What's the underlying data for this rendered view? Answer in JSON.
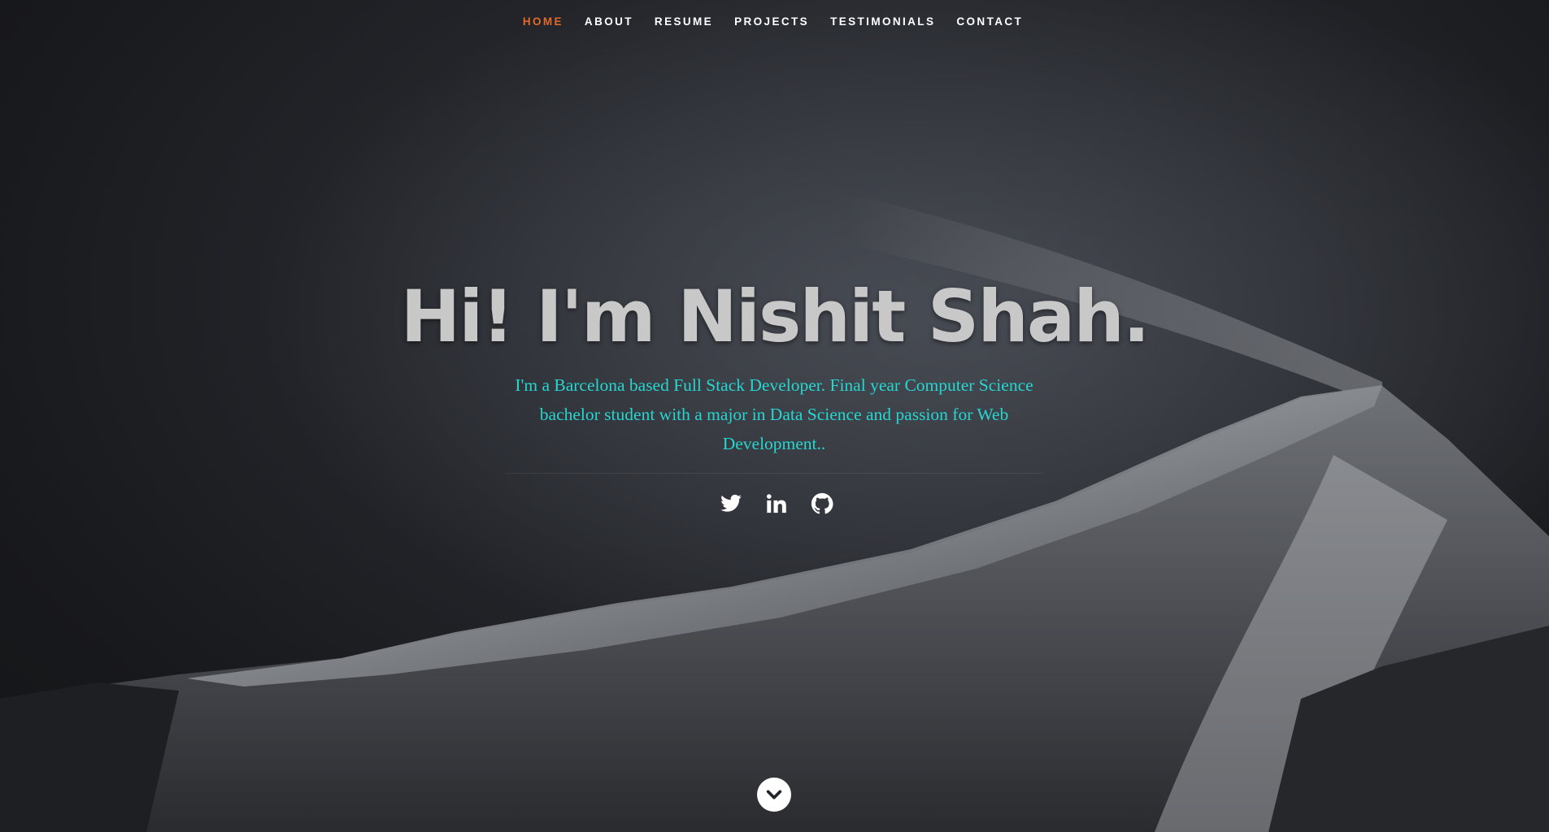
{
  "nav": {
    "items": [
      {
        "label": "HOME",
        "active": true
      },
      {
        "label": "ABOUT",
        "active": false
      },
      {
        "label": "RESUME",
        "active": false
      },
      {
        "label": "PROJECTS",
        "active": false
      },
      {
        "label": "TESTIMONIALS",
        "active": false
      },
      {
        "label": "CONTACT",
        "active": false
      }
    ]
  },
  "hero": {
    "headline": "Hi! I'm Nishit Shah.",
    "intro": "I'm a Barcelona based Full Stack Developer. Final year Computer Science bachelor student with a major in Data Science and passion for Web Development..",
    "social": [
      {
        "icon": "twitter-icon"
      },
      {
        "icon": "linkedin-icon"
      },
      {
        "icon": "github-icon"
      }
    ],
    "scroll_icon": "chevron-down-icon"
  },
  "colors": {
    "nav_active": "#e2682a",
    "nav_text": "#ffffff",
    "headline": "#c8c8c8",
    "intro": "#26d6d0"
  }
}
